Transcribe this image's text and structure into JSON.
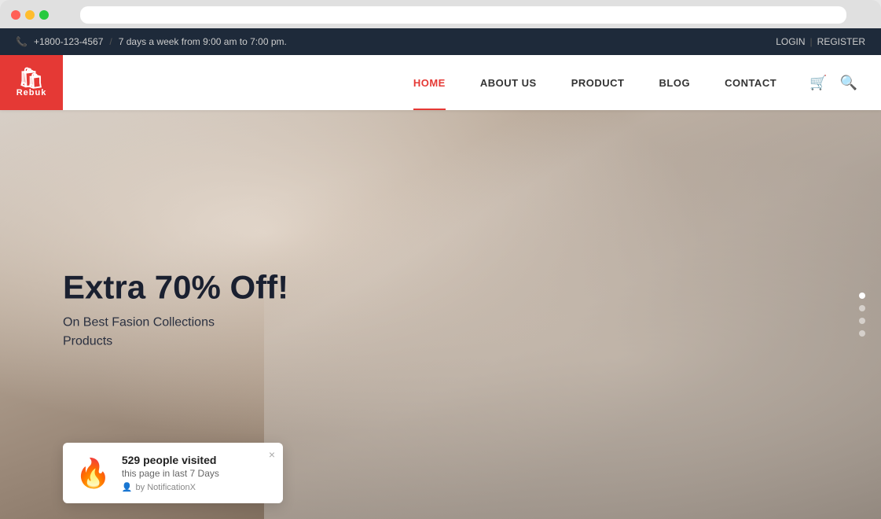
{
  "browser": {
    "dots": [
      "red",
      "yellow",
      "green"
    ]
  },
  "topbar": {
    "phone_icon": "📞",
    "phone_number": "+1800-123-4567",
    "separator": "/",
    "hours": "7 days a week from 9:00 am to 7:00 pm.",
    "login_label": "LOGIN",
    "divider": "|",
    "register_label": "REGISTER"
  },
  "header": {
    "logo_text": "Rebuk",
    "nav_items": [
      {
        "label": "HOME",
        "active": true
      },
      {
        "label": "ABOUT US",
        "active": false
      },
      {
        "label": "PRODUCT",
        "active": false
      },
      {
        "label": "BLOG",
        "active": false
      },
      {
        "label": "CONTACT",
        "active": false
      }
    ],
    "cart_icon": "🛒",
    "search_icon": "🔍"
  },
  "hero": {
    "title": "Extra 70% Off!",
    "subtitle_line1": "On Best Fasion Collections",
    "subtitle_line2": "Products",
    "slider_dots": [
      {
        "active": true
      },
      {
        "active": false
      },
      {
        "active": false
      },
      {
        "active": false
      }
    ]
  },
  "notification": {
    "fire_emoji": "🔥",
    "visitors_count": "529",
    "visitors_label": "people visited",
    "subtitle": "this page in last 7 Days",
    "brand_icon": "👤",
    "brand_label": "by NotificationX",
    "close_label": "×"
  }
}
